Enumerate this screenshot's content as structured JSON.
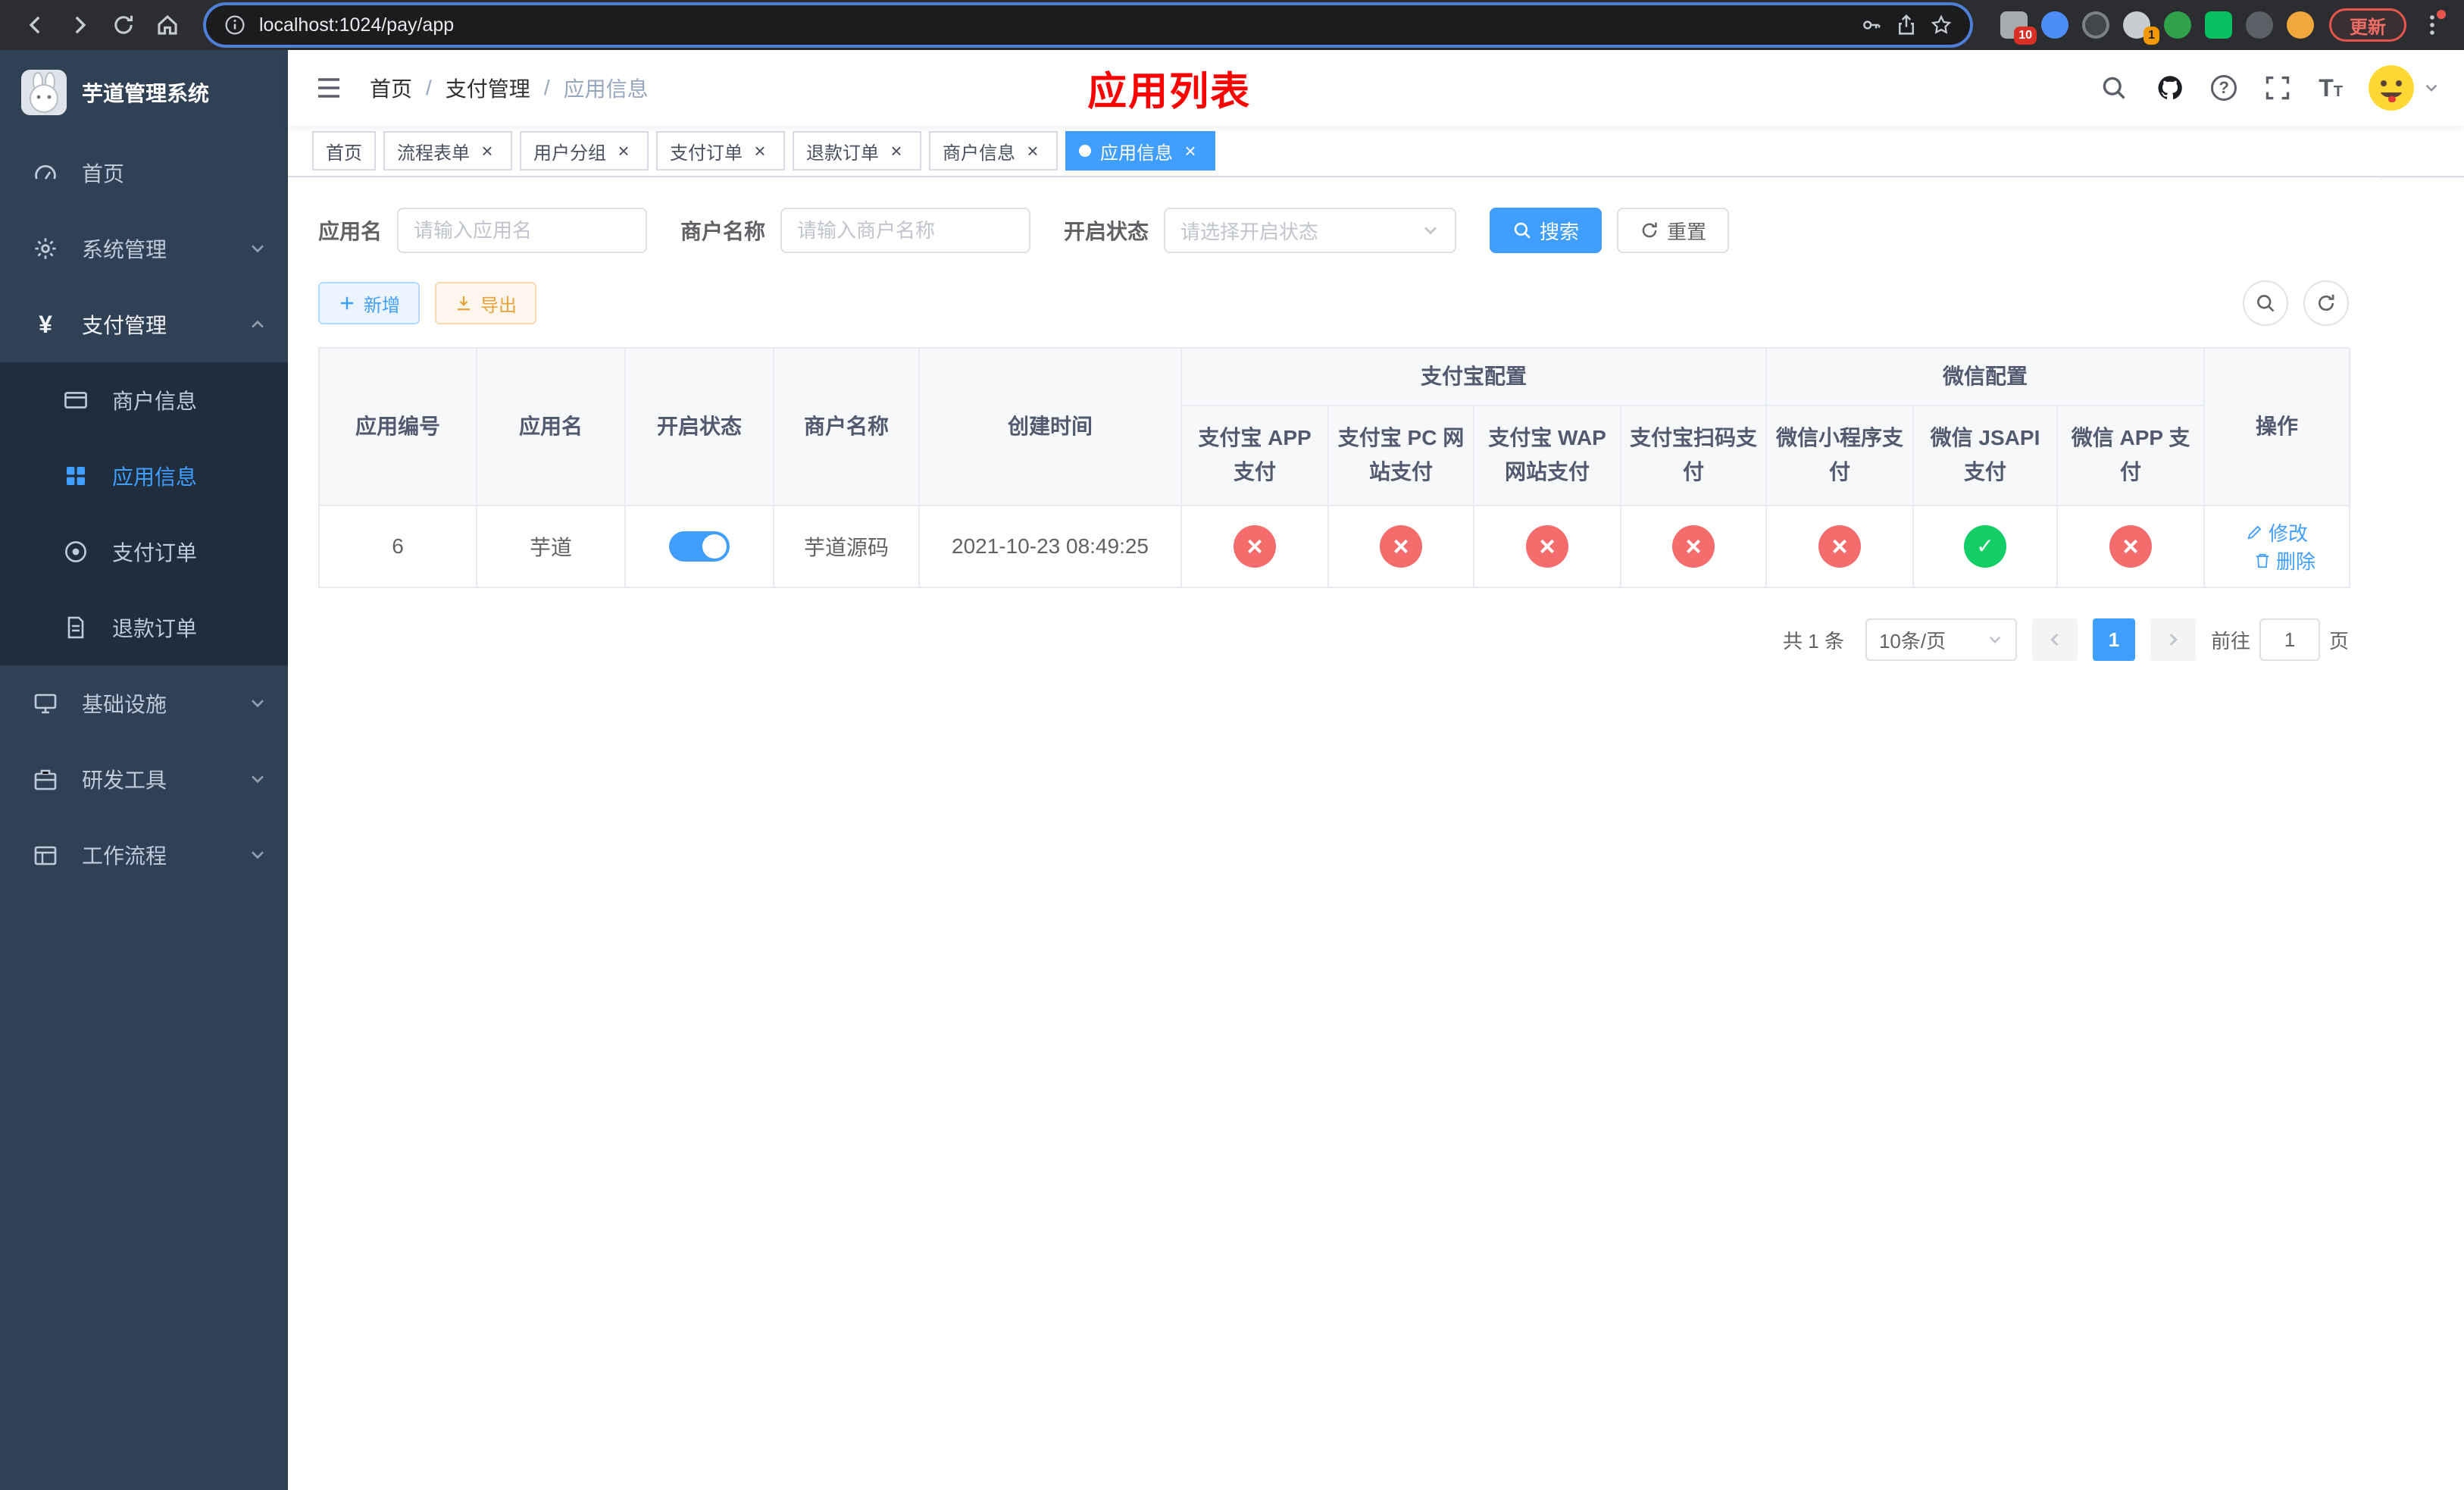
{
  "browser": {
    "url": "localhost:1024/pay/app",
    "update_label": "更新",
    "ext_badges": [
      "10",
      "1"
    ]
  },
  "sidebar": {
    "title": "芋道管理系统",
    "items": [
      {
        "label": "首页"
      },
      {
        "label": "系统管理"
      },
      {
        "label": "支付管理",
        "expanded": true,
        "children": [
          {
            "label": "商户信息"
          },
          {
            "label": "应用信息",
            "active": true
          },
          {
            "label": "支付订单"
          },
          {
            "label": "退款订单"
          }
        ]
      },
      {
        "label": "基础设施"
      },
      {
        "label": "研发工具"
      },
      {
        "label": "工作流程"
      }
    ]
  },
  "header": {
    "breadcrumb": [
      "首页",
      "支付管理",
      "应用信息"
    ],
    "page_title": "应用列表"
  },
  "tabs": [
    {
      "label": "首页",
      "closable": false,
      "active": false
    },
    {
      "label": "流程表单",
      "closable": true,
      "active": false
    },
    {
      "label": "用户分组",
      "closable": true,
      "active": false
    },
    {
      "label": "支付订单",
      "closable": true,
      "active": false
    },
    {
      "label": "退款订单",
      "closable": true,
      "active": false
    },
    {
      "label": "商户信息",
      "closable": true,
      "active": false
    },
    {
      "label": "应用信息",
      "closable": true,
      "active": true
    }
  ],
  "filter": {
    "app_name_label": "应用名",
    "app_name_placeholder": "请输入应用名",
    "merchant_label": "商户名称",
    "merchant_placeholder": "请输入商户名称",
    "status_label": "开启状态",
    "status_placeholder": "请选择开启状态",
    "search_label": "搜索",
    "reset_label": "重置"
  },
  "toolbar": {
    "add_label": "新增",
    "export_label": "导出"
  },
  "table": {
    "headers": {
      "app_id": "应用编号",
      "app_name": "应用名",
      "status": "开启状态",
      "merchant_name": "商户名称",
      "create_time": "创建时间",
      "alipay_group": "支付宝配置",
      "wechat_group": "微信配置",
      "actions": "操作",
      "alipay_app": "支付宝 APP 支付",
      "alipay_pc": "支付宝 PC 网站支付",
      "alipay_wap": "支付宝 WAP 网站支付",
      "alipay_qr": "支付宝扫码支付",
      "wechat_lite": "微信小程序支付",
      "wechat_jsapi": "微信 JSAPI 支付",
      "wechat_app": "微信 APP 支付"
    },
    "row": {
      "app_id": "6",
      "app_name": "芋道",
      "status_on": true,
      "merchant_name": "芋道源码",
      "create_time": "2021-10-23 08:49:25",
      "alipay_app": "disabled",
      "alipay_pc": "disabled",
      "alipay_wap": "disabled",
      "alipay_qr": "disabled",
      "wechat_lite": "disabled",
      "wechat_jsapi": "enabled",
      "wechat_app": "disabled",
      "edit_label": "修改",
      "delete_label": "删除"
    }
  },
  "pagination": {
    "total": "共 1 条",
    "page_size": "10条/页",
    "current_page": "1",
    "goto_prefix": "前往",
    "goto_value": "1",
    "goto_suffix": "页"
  },
  "colors": {
    "primary": "#409eff",
    "danger": "#f56c6c",
    "success": "#13ce66",
    "title_red": "#ff0000",
    "sidebar_bg": "#304156",
    "submenu_bg": "#1f2d3d"
  }
}
